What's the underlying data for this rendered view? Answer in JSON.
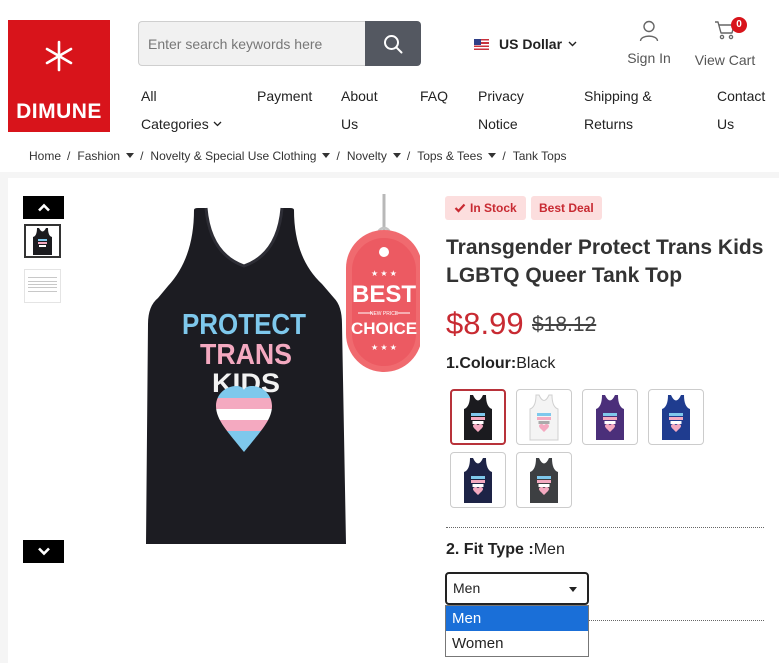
{
  "header": {
    "brand": "DIMUNE",
    "search_placeholder": "Enter search keywords here",
    "currency": "US Dollar",
    "sign_in": "Sign In",
    "view_cart": "View Cart",
    "cart_count": "0"
  },
  "nav": [
    {
      "line1": "All",
      "line2": "Categories"
    },
    {
      "line1": "Payment",
      "line2": ""
    },
    {
      "line1": "About",
      "line2": "Us"
    },
    {
      "line1": "FAQ",
      "line2": ""
    },
    {
      "line1": "Privacy",
      "line2": "Notice"
    },
    {
      "line1": "Shipping &",
      "line2": "Returns"
    },
    {
      "line1": "Contact",
      "line2": "Us"
    }
  ],
  "breadcrumb": [
    "Home",
    "Fashion",
    "Novelty & Special Use Clothing",
    "Novelty",
    "Tops & Tees",
    "Tank Tops"
  ],
  "product": {
    "in_stock": "In Stock",
    "best_deal": "Best Deal",
    "title": "Transgender Protect Trans Kids LGBTQ Queer Tank Top",
    "price": "$8.99",
    "old_price": "$18.12",
    "image_text": {
      "line1": "PROTECT",
      "line2": "TRANS",
      "line3": "KIDS"
    },
    "tag": {
      "best": "BEST",
      "sub": "NEW PRICE",
      "choice": "CHOICE"
    },
    "colour_label": "1.Colour:",
    "colour_value": "Black",
    "colours": [
      {
        "name": "Black",
        "hex": "#1b1b1f"
      },
      {
        "name": "White",
        "hex": "#f4f4f4"
      },
      {
        "name": "Purple",
        "hex": "#4b2f7a"
      },
      {
        "name": "Royal Blue",
        "hex": "#1f3c8f"
      },
      {
        "name": "Navy",
        "hex": "#1d2346"
      },
      {
        "name": "Dark Heather",
        "hex": "#3d3f42"
      }
    ],
    "fit_label": "2. Fit Type :",
    "fit_value": "Men",
    "fit_selected": "Men",
    "fit_options": [
      "Men",
      "Women"
    ]
  },
  "colors": {
    "brand_red": "#d8141b",
    "price_red": "#c82a32",
    "select_highlight": "#1a6fd8"
  }
}
